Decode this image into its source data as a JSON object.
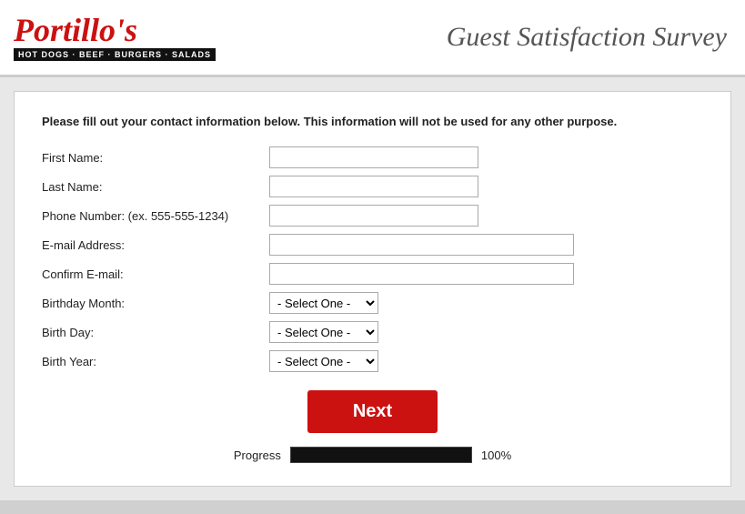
{
  "header": {
    "logo_text": "Portillo's",
    "logo_tagline": "HOT DOGS · BEEF · BURGERS · SALADS",
    "survey_title": "Guest Satisfaction Survey"
  },
  "form": {
    "instruction": "Please fill out your contact information below. This information will not be used for any other purpose.",
    "fields": [
      {
        "label": "First Name:",
        "type": "text",
        "size": "short",
        "id": "first-name"
      },
      {
        "label": "Last Name:",
        "type": "text",
        "size": "short",
        "id": "last-name"
      },
      {
        "label": "Phone Number: (ex. 555-555-1234)",
        "type": "text",
        "size": "short",
        "id": "phone"
      },
      {
        "label": "E-mail Address:",
        "type": "text",
        "size": "long",
        "id": "email"
      },
      {
        "label": "Confirm E-mail:",
        "type": "text",
        "size": "long",
        "id": "confirm-email"
      },
      {
        "label": "Birthday Month:",
        "type": "select",
        "id": "birth-month"
      },
      {
        "label": "Birth Day:",
        "type": "select",
        "id": "birth-day"
      },
      {
        "label": "Birth Year:",
        "type": "select",
        "id": "birth-year"
      }
    ],
    "select_default": "- Select One -",
    "next_button": "Next"
  },
  "progress": {
    "label": "Progress",
    "percent": "100%",
    "value": 100
  }
}
